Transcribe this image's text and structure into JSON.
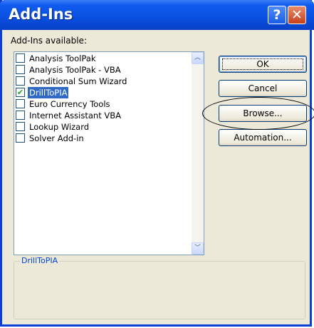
{
  "window": {
    "title": "Add-Ins",
    "help_label": "?",
    "close_label": "✕"
  },
  "list": {
    "label": "Add-Ins available:",
    "items": [
      {
        "label": "Analysis ToolPak",
        "checked": false
      },
      {
        "label": "Analysis ToolPak - VBA",
        "checked": false
      },
      {
        "label": "Conditional Sum Wizard",
        "checked": false
      },
      {
        "label": "DrillToPIA",
        "checked": true,
        "selected": true
      },
      {
        "label": "Euro Currency Tools",
        "checked": false
      },
      {
        "label": "Internet Assistant VBA",
        "checked": false
      },
      {
        "label": "Lookup Wizard",
        "checked": false
      },
      {
        "label": "Solver Add-in",
        "checked": false
      }
    ],
    "check_mark": "✔",
    "scroll_up": "︿",
    "scroll_down": "﹀"
  },
  "buttons": {
    "ok": "OK",
    "cancel": "Cancel",
    "browse": "Browse...",
    "automation": "Automation..."
  },
  "details": {
    "title": "DrillToPIA"
  },
  "colors": {
    "titlebar": "#0a4fe0",
    "selection": "#316ac5",
    "dialog_bg": "#ece9d8",
    "close_button": "#c8401d"
  }
}
